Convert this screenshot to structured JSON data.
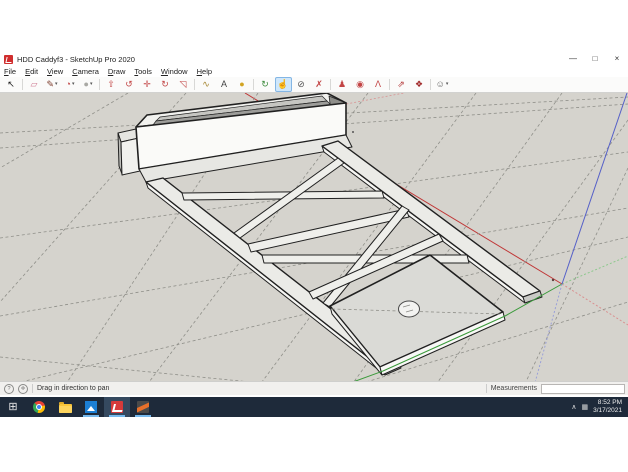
{
  "window": {
    "title": "HDD Caddyf3 - SketchUp Pro 2020",
    "controls": {
      "minimize": "—",
      "maximize": "□",
      "close": "×"
    }
  },
  "menu": {
    "items": [
      "File",
      "Edit",
      "View",
      "Camera",
      "Draw",
      "Tools",
      "Window",
      "Help"
    ]
  },
  "toolbar": {
    "tools": [
      {
        "name": "select-tool",
        "glyph": "↖",
        "color": "#1a1a1a",
        "sep_after": true
      },
      {
        "name": "eraser-tool",
        "glyph": "▱",
        "color": "#cf7b93"
      },
      {
        "name": "line-tool",
        "glyph": "✎",
        "color": "#7c3a2a",
        "dd": true
      },
      {
        "name": "arc-tool",
        "glyph": "◔",
        "color": "#bf4040",
        "dd": true
      },
      {
        "name": "shapes-tool",
        "glyph": "●",
        "color": "#a9a9a4",
        "dd": true,
        "sep_after": true
      },
      {
        "name": "pushpull-tool",
        "glyph": "⇧",
        "color": "#c24444"
      },
      {
        "name": "offset-tool",
        "glyph": "↺",
        "color": "#c24444"
      },
      {
        "name": "move-tool",
        "glyph": "✛",
        "color": "#c24444"
      },
      {
        "name": "rotate-tool",
        "glyph": "↻",
        "color": "#c24444"
      },
      {
        "name": "scale-tool",
        "glyph": "◹",
        "color": "#c24444",
        "sep_after": true
      },
      {
        "name": "tape-measure-tool",
        "glyph": "∿",
        "color": "#a5852f"
      },
      {
        "name": "text-tool",
        "glyph": "A",
        "color": "#444444"
      },
      {
        "name": "paint-bucket-tool",
        "glyph": "●",
        "color": "#d2a422",
        "sep_after": true
      },
      {
        "name": "orbit-tool",
        "glyph": "↻",
        "color": "#3a8a3a"
      },
      {
        "name": "pan-tool",
        "glyph": "☝",
        "color": "#b98a50",
        "sel": true
      },
      {
        "name": "zoom-tool",
        "glyph": "⊘",
        "color": "#555555"
      },
      {
        "name": "zoom-extents-tool",
        "glyph": "✗",
        "color": "#c24444",
        "sep_after": true
      },
      {
        "name": "position-camera-tool",
        "glyph": "♟",
        "color": "#c24444"
      },
      {
        "name": "look-around-tool",
        "glyph": "◉",
        "color": "#c24444"
      },
      {
        "name": "walk-tool",
        "glyph": "Λ",
        "color": "#c24444",
        "sep_after": true
      },
      {
        "name": "share-model-button",
        "glyph": "⇗",
        "color": "#b03030"
      },
      {
        "name": "warehouse-button",
        "glyph": "❖",
        "color": "#a02828",
        "sep_after": true
      },
      {
        "name": "account-button",
        "glyph": "☺",
        "color": "#666666",
        "dd": true
      }
    ],
    "dropdown_glyph": "▾"
  },
  "viewport": {
    "background": "#d5d3cd",
    "axis_colors": {
      "red": "#c03636",
      "green": "#3a9a3a",
      "blue": "#5560c8"
    },
    "model_name": "hdd-caddy-3d-model"
  },
  "statusbar": {
    "icons": [
      {
        "name": "help-icon",
        "glyph": "?"
      },
      {
        "name": "geolocate-icon",
        "glyph": "✛"
      }
    ],
    "hint": "Drag in direction to pan",
    "measurements_label": "Measurements",
    "measurements_value": ""
  },
  "taskbar": {
    "background": "#1e2a3a",
    "apps": [
      {
        "name": "start-button"
      },
      {
        "name": "chrome"
      },
      {
        "name": "file-explorer"
      },
      {
        "name": "photos",
        "running": true
      },
      {
        "name": "sketchup",
        "running": true,
        "active": true
      },
      {
        "name": "slicer",
        "running": true
      }
    ],
    "tray": {
      "expand_glyph": "∧",
      "status_glyph": "▦"
    },
    "clock_time": "8:52 PM",
    "clock_date": "3/17/2021"
  }
}
